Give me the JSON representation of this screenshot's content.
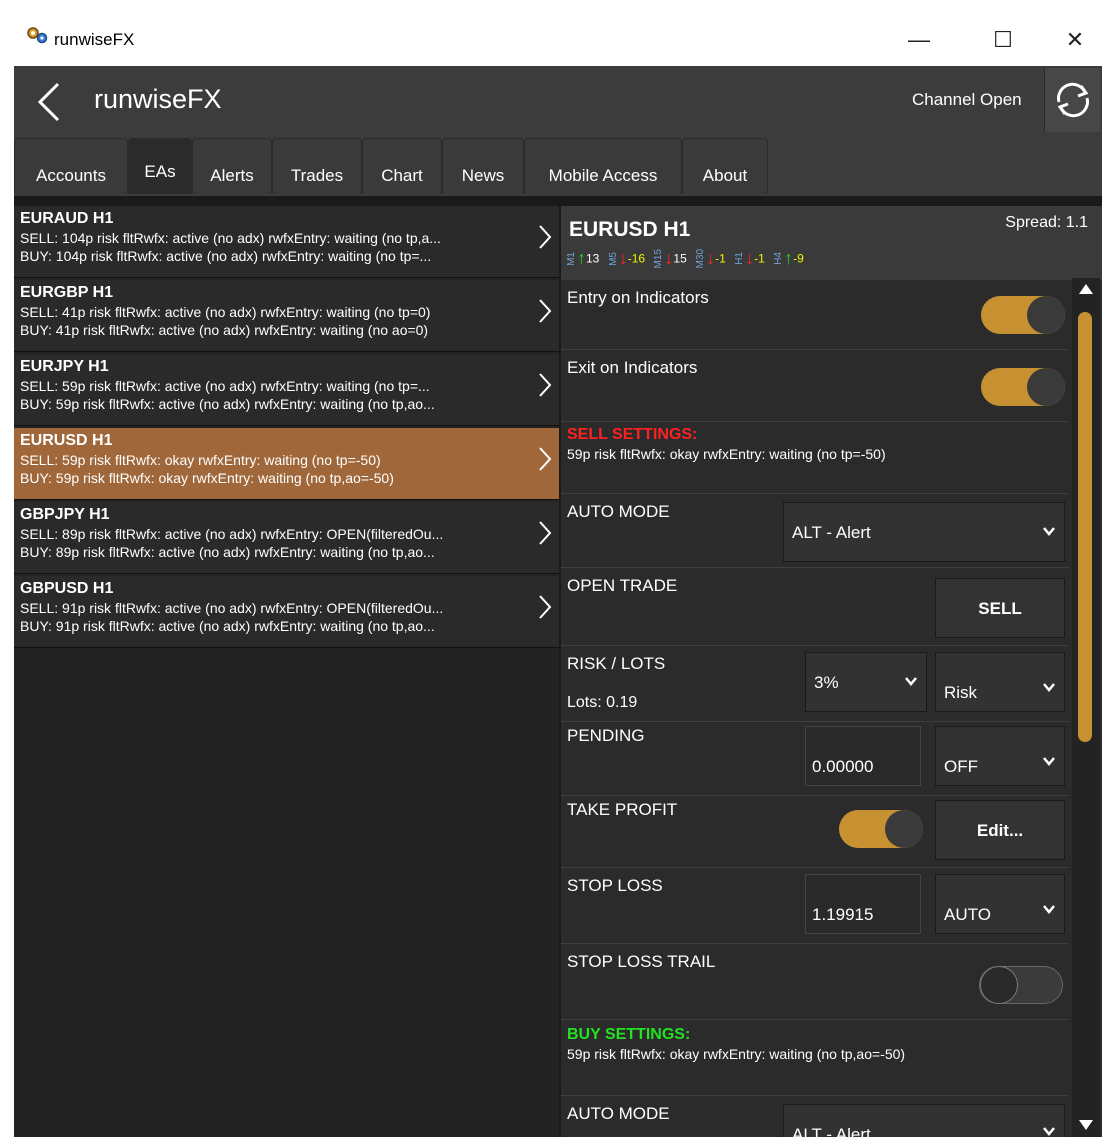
{
  "window": {
    "title": "runwiseFX",
    "minimize": "—",
    "maximize": "☐",
    "close": "✕"
  },
  "header": {
    "title": "runwiseFX",
    "status": "Channel Open"
  },
  "tabs": [
    "Accounts",
    "EAs",
    "Alerts",
    "Trades",
    "Chart",
    "News",
    "Mobile Access",
    "About"
  ],
  "ea_list": [
    {
      "name": "EURAUD H1",
      "sell": "SELL: 104p risk  fltRwfx: active (no adx)   rwfxEntry: waiting (no tp,a...",
      "buy": "BUY: 104p risk  fltRwfx: active (no adx)   rwfxEntry: waiting (no tp=..."
    },
    {
      "name": "EURGBP H1",
      "sell": "SELL: 41p risk  fltRwfx: active (no adx)   rwfxEntry: waiting (no tp=0)",
      "buy": "BUY: 41p risk  fltRwfx: active (no adx)   rwfxEntry: waiting (no ao=0)"
    },
    {
      "name": "EURJPY H1",
      "sell": "SELL: 59p risk  fltRwfx: active (no adx)   rwfxEntry: waiting (no tp=...",
      "buy": "BUY: 59p risk  fltRwfx: active (no adx)   rwfxEntry: waiting (no tp,ao..."
    },
    {
      "name": "EURUSD H1",
      "sell": "SELL: 59p risk  fltRwfx: okay   rwfxEntry: waiting (no tp=-50)",
      "buy": "BUY: 59p risk  fltRwfx: okay   rwfxEntry: waiting (no tp,ao=-50)"
    },
    {
      "name": "GBPJPY H1",
      "sell": "SELL: 89p risk  fltRwfx: active (no adx)   rwfxEntry: OPEN(filteredOu...",
      "buy": "BUY: 89p risk  fltRwfx: active (no adx)   rwfxEntry: waiting (no tp,ao..."
    },
    {
      "name": "GBPUSD H1",
      "sell": "SELL: 91p risk  fltRwfx: active (no adx)   rwfxEntry: OPEN(filteredOu...",
      "buy": "BUY: 91p risk  fltRwfx: active (no adx)   rwfxEntry: waiting (no tp,ao..."
    }
  ],
  "selected_index": 3,
  "detail": {
    "title": "EURUSD H1",
    "spread": "Spread: 1.1",
    "timeframes": [
      {
        "name": "M1",
        "dir": "up",
        "value": "13",
        "value_color": "white"
      },
      {
        "name": "M5",
        "dir": "down",
        "value": "-16",
        "value_color": "yellow"
      },
      {
        "name": "M15",
        "dir": "down",
        "value": "15",
        "value_color": "white"
      },
      {
        "name": "M30",
        "dir": "down",
        "value": "-1",
        "value_color": "yellow"
      },
      {
        "name": "H1",
        "dir": "down",
        "value": "-1",
        "value_color": "yellow"
      },
      {
        "name": "H4",
        "dir": "up",
        "value": "-9",
        "value_color": "yellow"
      }
    ],
    "entry_on_indicators": "Entry on Indicators",
    "exit_on_indicators": "Exit on Indicators",
    "sell_settings_title": "SELL SETTINGS:",
    "sell_settings_text": "59p risk  fltRwfx: okay   rwfxEntry: waiting (no tp=-50)",
    "auto_mode_label": "AUTO MODE",
    "auto_mode_value": "ALT - Alert",
    "open_trade_label": "OPEN TRADE",
    "open_trade_button": "SELL",
    "risk_lots_label": "RISK / LOTS",
    "lots_text": "Lots: 0.19",
    "risk_value": "3%",
    "risk_mode": "Risk",
    "pending_label": "PENDING",
    "pending_value": "0.00000",
    "pending_mode": "OFF",
    "take_profit_label": "TAKE PROFIT",
    "take_profit_button": "Edit...",
    "stop_loss_label": "STOP LOSS",
    "stop_loss_value": "1.19915",
    "stop_loss_mode": "AUTO",
    "stop_loss_trail_label": "STOP LOSS TRAIL",
    "buy_settings_title": "BUY SETTINGS:",
    "buy_settings_text": "59p risk  fltRwfx: okay   rwfxEntry: waiting (no tp,ao=-50)",
    "buy_auto_mode_label": "AUTO MODE",
    "buy_auto_mode_value": "ALT - Alert"
  },
  "colors": {
    "accent": "#c79132",
    "selected_row": "#a0683a",
    "sell": "#ff2020",
    "buy": "#22e222"
  },
  "toggles": {
    "entry_on_indicators": true,
    "exit_on_indicators": true,
    "take_profit": true,
    "stop_loss_trail": false
  }
}
